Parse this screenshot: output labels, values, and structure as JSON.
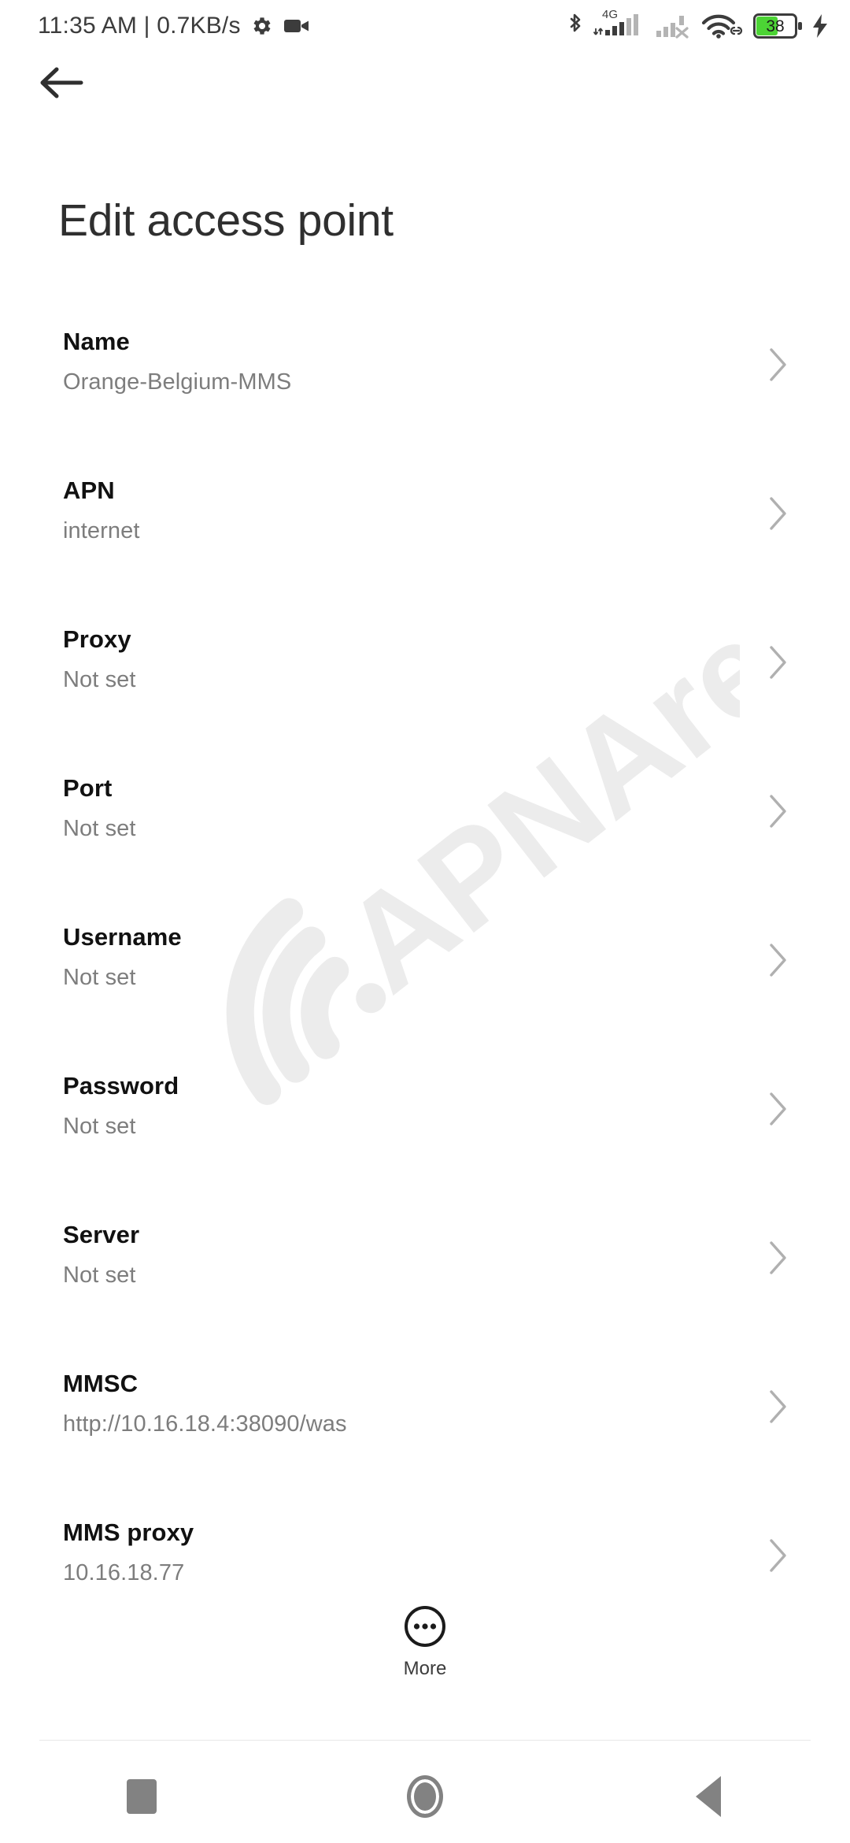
{
  "statusbar": {
    "clock": "11:35 AM | 0.7KB/s",
    "gear_icon": "gear-icon",
    "video_icon": "video-camera-icon",
    "bluetooth_icon": "bluetooth-icon",
    "network_type": "4G",
    "signal_icon": "cellular-signal-icon",
    "signal2_icon": "cellular-signal-no-service-icon",
    "wifi_icon": "wifi-icon",
    "vpn_icon": "vpn-link-icon",
    "battery_level": "38",
    "battery_icon": "battery-icon",
    "charging_icon": "charging-bolt-icon",
    "battery_fill_color": "#4CD435",
    "icon_color": "#3c3c3c"
  },
  "appbar": {
    "back_icon": "back-arrow-icon",
    "title": "Edit access point"
  },
  "watermark": {
    "text": "APNArena",
    "icon": "wifi-signal-icon",
    "color": "#ececec"
  },
  "list": {
    "chevron_icon": "chevron-right-icon",
    "items": [
      {
        "title": "Name",
        "value": "Orange-Belgium-MMS"
      },
      {
        "title": "APN",
        "value": "internet"
      },
      {
        "title": "Proxy",
        "value": "Not set"
      },
      {
        "title": "Port",
        "value": "Not set"
      },
      {
        "title": "Username",
        "value": "Not set"
      },
      {
        "title": "Password",
        "value": "Not set"
      },
      {
        "title": "Server",
        "value": "Not set"
      },
      {
        "title": "MMSC",
        "value": "http://10.16.18.4:38090/was"
      },
      {
        "title": "MMS proxy",
        "value": "10.16.18.77"
      }
    ]
  },
  "more": {
    "label": "More",
    "icon": "more-dots-circle-icon"
  },
  "navbar": {
    "recents_icon": "recents-square-icon",
    "home_icon": "home-circle-icon",
    "back_icon": "back-triangle-icon"
  }
}
